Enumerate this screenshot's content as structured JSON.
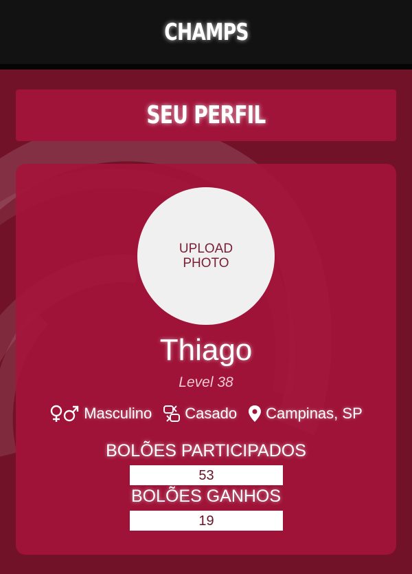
{
  "header": {
    "brand": "CHAMPS"
  },
  "page": {
    "title": "SEU PERFIL"
  },
  "profile": {
    "upload_photo_line1": "UPLOAD",
    "upload_photo_line2": "PHOTO",
    "name": "Thiago",
    "level": "Level 38",
    "gender": {
      "icon": "gender-icon",
      "label": "Masculino"
    },
    "marital_status": {
      "icon": "rings-icon",
      "label": "Casado"
    },
    "location": {
      "icon": "location-pin-icon",
      "label": "Campinas, SP"
    }
  },
  "stats": {
    "participated_label": "BOLÕES PARTICIPADOS",
    "participated_value": "53",
    "won_label": "BOLÕES GANHOS",
    "won_value": "19"
  },
  "colors": {
    "header_bg": "#121212",
    "page_bg": "#721229",
    "card_bg": "#a4143a",
    "photo_bg": "#f0f0f0",
    "text": "#ffffff"
  }
}
